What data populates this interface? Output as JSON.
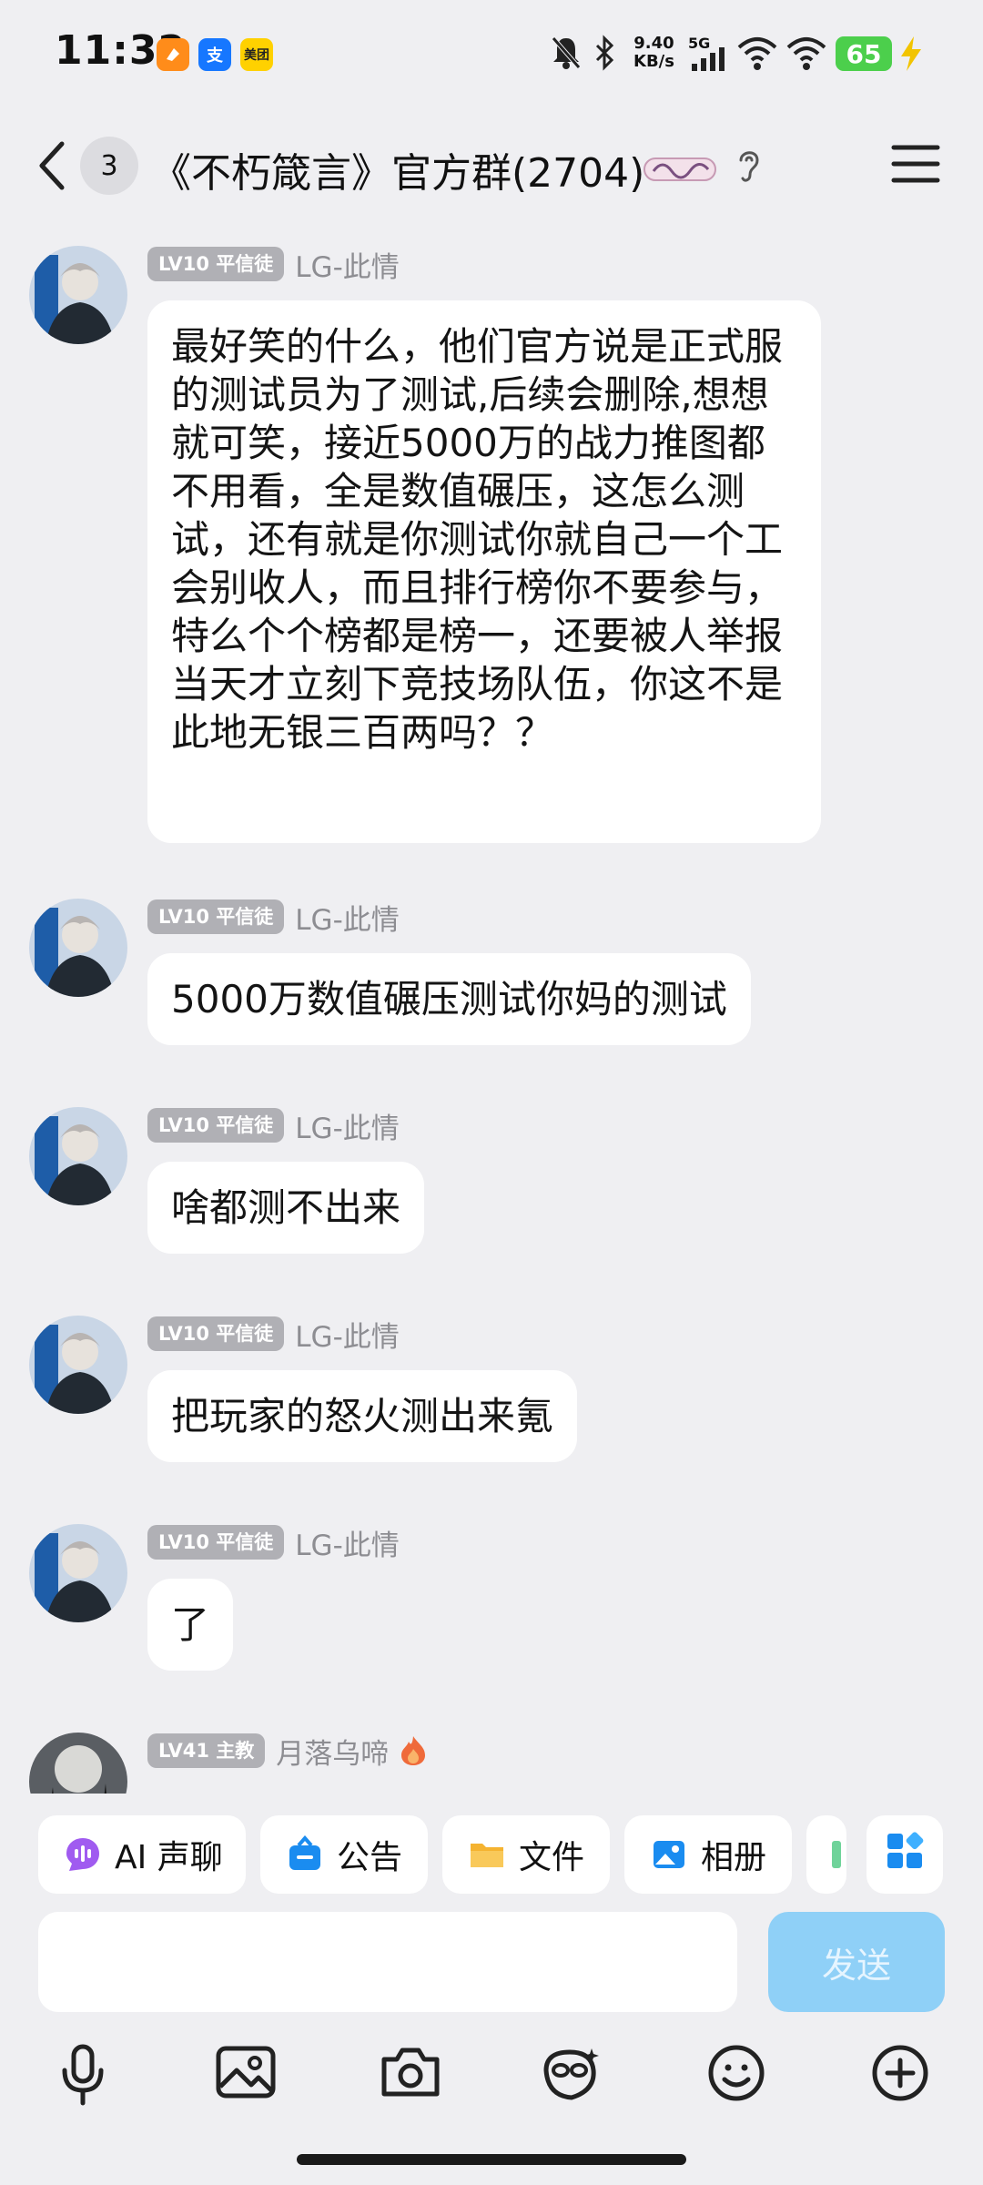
{
  "status_bar": {
    "time": "11:32",
    "app_icons": [
      {
        "label": "",
        "color": "#ff8c1a",
        "name": "app-orange-icon"
      },
      {
        "label": "支",
        "color": "#1677ff",
        "name": "alipay-icon"
      },
      {
        "label": "美团",
        "color": "#ffd100",
        "name": "meituan-icon"
      }
    ],
    "speed_value": "9.40",
    "speed_unit": "KB/s",
    "network": "5G",
    "battery": "65"
  },
  "header": {
    "unread_count": "3",
    "title": "《不朽箴言》官方群(2704)"
  },
  "messages": [
    {
      "level": "LV10 平信徒",
      "sender": "LG-此情",
      "text": "最好笑的什么，他们官方说是正式服的测试员为了测试,后续会删除,想想就可笑，接近5000万的战力推图都不用看，全是数值碾压，这怎么测试，还有就是你测试你就自己一个工会别收人，而且排行榜你不要参与，特么个个榜都是榜一，还要被人举报当天才立刻下竞技场队伍，你这不是此地无银三百两吗？？"
    },
    {
      "level": "LV10 平信徒",
      "sender": "LG-此情",
      "text": "5000万数值碾压测试你妈的测试"
    },
    {
      "level": "LV10 平信徒",
      "sender": "LG-此情",
      "text": "啥都测不出来"
    },
    {
      "level": "LV10 平信徒",
      "sender": "LG-此情",
      "text": "把玩家的怒火测出来氪"
    },
    {
      "level": "LV10 平信徒",
      "sender": "LG-此情",
      "text": "了"
    },
    {
      "level": "LV41 主教",
      "sender": "月落乌啼",
      "text": ""
    }
  ],
  "quick_actions": [
    {
      "label": "AI 声聊",
      "icon": "ai-voice-icon",
      "color": "#a05bf0"
    },
    {
      "label": "公告",
      "icon": "announcement-icon",
      "color": "#1a8cf0"
    },
    {
      "label": "文件",
      "icon": "folder-icon",
      "color": "#f5b330"
    },
    {
      "label": "相册",
      "icon": "album-icon",
      "color": "#1a8cf0"
    }
  ],
  "input": {
    "send_label": "发送",
    "placeholder": ""
  },
  "bottom_icons": [
    "microphone-icon",
    "image-icon",
    "camera-icon",
    "sticker-icon",
    "emoji-icon",
    "plus-icon"
  ]
}
